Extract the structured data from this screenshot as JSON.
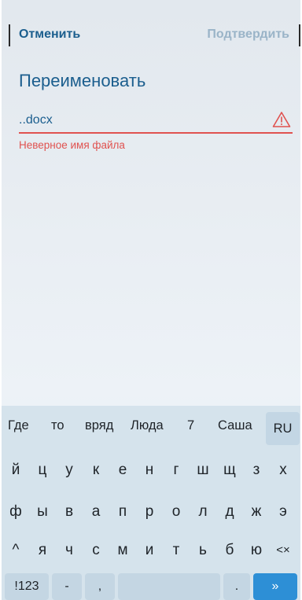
{
  "header": {
    "cancel_label": "Отменить",
    "confirm_label": "Подтвердить"
  },
  "dialog": {
    "title": "Переименовать",
    "filename_value": "..docx",
    "error_message": "Неверное имя файла",
    "warning_icon": "warning-triangle-icon",
    "error_color": "#e0524f",
    "accent_color": "#1b5e8e"
  },
  "keyboard": {
    "suggestions": [
      "Где",
      "то",
      "вряд",
      "Люда",
      "7",
      "Саша"
    ],
    "language": "RU",
    "row1": [
      "й",
      "ц",
      "у",
      "к",
      "е",
      "н",
      "г",
      "ш",
      "щ",
      "з",
      "х"
    ],
    "row2": [
      "ф",
      "ы",
      "в",
      "а",
      "п",
      "р",
      "о",
      "л",
      "д",
      "ж",
      "э"
    ],
    "row3_shift": "^",
    "row3": [
      "я",
      "ч",
      "с",
      "м",
      "и",
      "т",
      "ь",
      "б",
      "ю"
    ],
    "row3_backspace": "<×",
    "numbers_label": "!123",
    "dash_label": "-",
    "comma_label": ",",
    "space_label": "",
    "period_label": ".",
    "enter_label": "»",
    "enter_color": "#2d8fd6"
  }
}
